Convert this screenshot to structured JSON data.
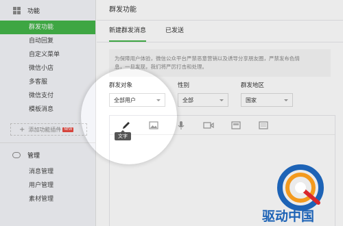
{
  "sidebar": {
    "section_function": "功能",
    "function_items": [
      {
        "label": "群发功能",
        "active": true
      },
      {
        "label": "自动回复"
      },
      {
        "label": "自定义菜单"
      },
      {
        "label": "微信小店"
      },
      {
        "label": "多客服"
      },
      {
        "label": "微信支付"
      },
      {
        "label": "模板消息"
      }
    ],
    "add_plugin": "添加功能插件",
    "add_plugin_badge": "NEW",
    "section_manage": "管理",
    "manage_items": [
      {
        "label": "消息管理"
      },
      {
        "label": "用户管理"
      },
      {
        "label": "素材管理"
      }
    ]
  },
  "main": {
    "title": "群发功能",
    "tabs": [
      {
        "label": "新建群发消息",
        "active": true
      },
      {
        "label": "已发送"
      }
    ],
    "notice_line1": "为保障用户体验，微信公众平台严禁恶意营销以及诱导分享朋友圈，严禁发布色情",
    "notice_line2": "息，一旦发现，我们将严厉打击和处理。",
    "fields": {
      "target_label": "群发对象",
      "target_value": "全部用户",
      "gender_label": "性别",
      "gender_value": "全部",
      "region_label": "群发地区",
      "region_value": "国家"
    },
    "toolbar": {
      "tooltip": "文字"
    }
  },
  "watermark": {
    "text": "驱动中国",
    "colors": {
      "blue": "#1d63b6",
      "orange": "#f39a1e",
      "red": "#d9262b"
    }
  },
  "colors": {
    "accent": "#44b549"
  }
}
